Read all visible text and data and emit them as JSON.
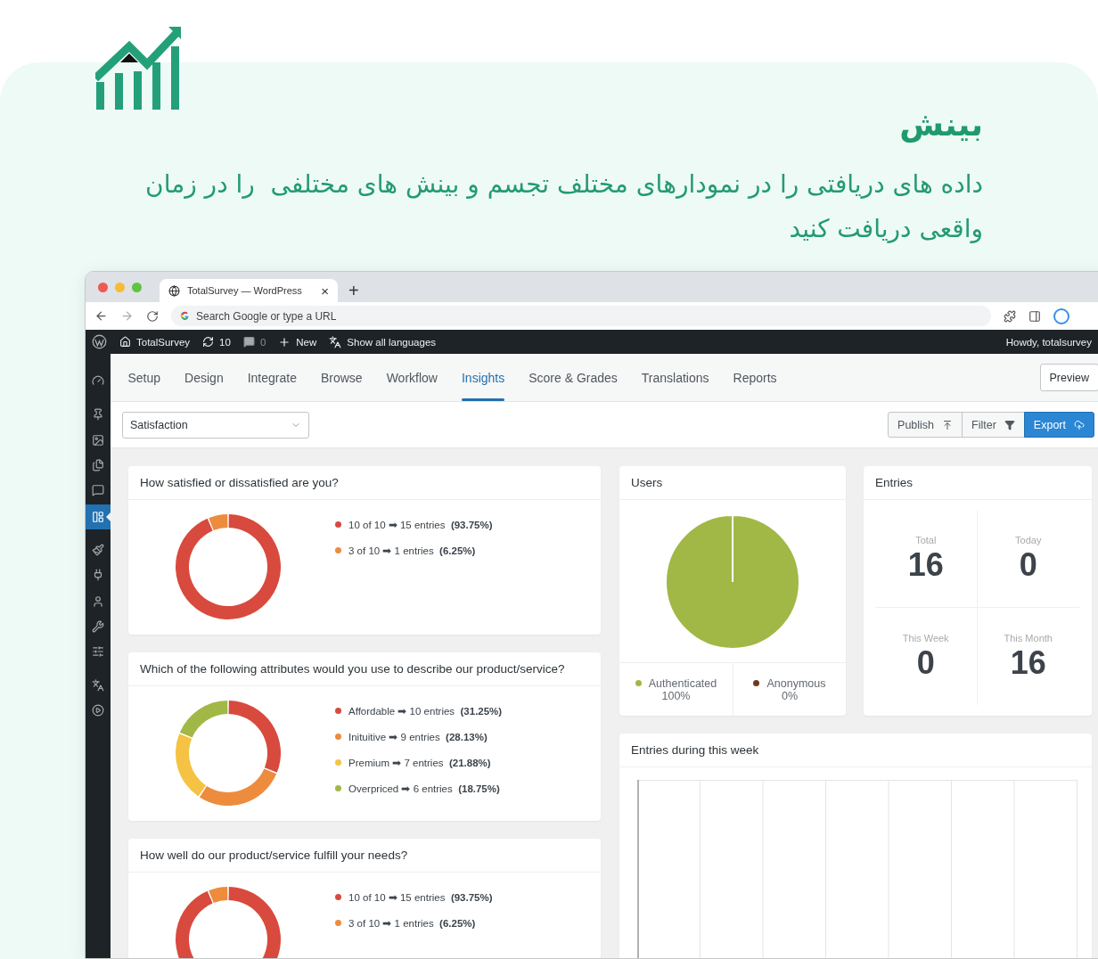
{
  "hero": {
    "title": "بینش",
    "description": "داده های دریافتی را در نمودارهای مختلف تجسم و بینش های مختلفی  را در زمان واقعی دریافت کنید"
  },
  "browser": {
    "tab_title": "TotalSurvey — WordPress",
    "tab_close": "×",
    "new_tab": "+",
    "address_placeholder": "Search Google or type a URL"
  },
  "admin_bar": {
    "site": "TotalSurvey",
    "updates": "10",
    "comments": "0",
    "new": "New",
    "languages": "Show all languages",
    "greeting": "Howdy, totalsurvey"
  },
  "sidebar": {
    "items": [
      {
        "selected": false
      },
      {
        "selected": false
      },
      {
        "selected": false
      },
      {
        "selected": false
      },
      {
        "selected": false
      },
      {
        "selected": true
      },
      {
        "selected": false
      },
      {
        "selected": false
      },
      {
        "selected": false
      },
      {
        "selected": false
      },
      {
        "selected": false
      },
      {
        "selected": false
      },
      {
        "selected": false
      }
    ]
  },
  "tabs": [
    {
      "label": "Setup",
      "selected": false
    },
    {
      "label": "Design",
      "selected": false
    },
    {
      "label": "Integrate",
      "selected": false
    },
    {
      "label": "Browse",
      "selected": false
    },
    {
      "label": "Workflow",
      "selected": false
    },
    {
      "label": "Insights",
      "selected": true
    },
    {
      "label": "Score & Grades",
      "selected": false
    },
    {
      "label": "Translations",
      "selected": false
    },
    {
      "label": "Reports",
      "selected": false
    }
  ],
  "preview_button": "Preview",
  "toolbar": {
    "select": {
      "value": "Satisfaction"
    },
    "buttons": [
      {
        "label": "Publish",
        "kind": "default"
      },
      {
        "label": "Filter",
        "kind": "default"
      },
      {
        "label": "Export",
        "kind": "primary"
      }
    ]
  },
  "question_cards": [
    {
      "title": "How satisfied or dissatisfied are you?",
      "legend": [
        {
          "entries": "➡ 15 entries",
          "percent": "(93.75%)",
          "color": "#d84a3e"
        },
        {
          "entries": "➡ 1 entries",
          "percent": "(6.25%)",
          "color": "#ee8c3d"
        }
      ],
      "chart_data": {
        "type": "donut",
        "categories": [
          "10 of 10",
          "3 of 10"
        ],
        "values": [
          93.75,
          6.25
        ]
      }
    },
    {
      "title": "Which of the following attributes would you use to describe our product/service?",
      "legend": [
        {
          "entries": "➡ 10 entries",
          "percent": "(31.25%)",
          "color": "#d84a3e"
        },
        {
          "entries": "➡ 9 entries",
          "percent": "(28.13%)",
          "color": "#ee8c3d"
        },
        {
          "entries": "➡ 7 entries",
          "percent": "(21.88%)",
          "color": "#f5c243"
        },
        {
          "entries": "➡ 6 entries",
          "percent": "(18.75%)",
          "color": "#a1b847"
        }
      ],
      "chart_data": {
        "type": "donut",
        "categories": [
          "Affordable",
          "Inituitive",
          "Premium",
          "Overpriced"
        ],
        "values": [
          31.25,
          28.13,
          21.88,
          18.75
        ]
      }
    },
    {
      "title": "How well do our product/service fulfill your needs?",
      "legend": [
        {
          "entries": "➡ 15 entries",
          "percent": "(93.75%)",
          "color": "#d84a3e"
        },
        {
          "entries": "➡ 1 entries",
          "percent": "(6.25%)",
          "color": "#ee8c3d"
        }
      ],
      "chart_data": {
        "type": "donut",
        "categories": [
          "10 of 10",
          "3 of 10"
        ],
        "values": [
          93.75,
          6.25
        ]
      }
    }
  ],
  "users_card": {
    "title": "Users",
    "chart_data": {
      "type": "pie",
      "categories": [
        "Authenticated",
        "Anonymous"
      ],
      "values": [
        100,
        0
      ]
    },
    "legend": [
      {
        "value": "100%",
        "color": "#a1b847"
      },
      {
        "value": "0%",
        "color": "#6b3a1f"
      }
    ]
  },
  "entries_card": {
    "title": "Entries",
    "stats": [
      {
        "label": "Total",
        "value": "16"
      },
      {
        "label": "Today",
        "value": "0"
      },
      {
        "label": "This Week",
        "value": "0"
      },
      {
        "label": "This Month",
        "value": "16"
      }
    ]
  },
  "week_card": {
    "title": "Entries during this week"
  }
}
